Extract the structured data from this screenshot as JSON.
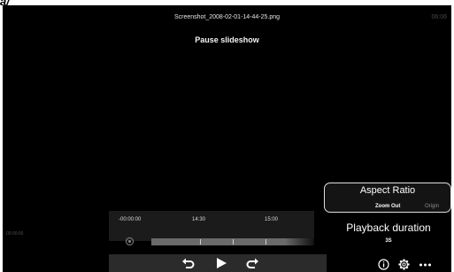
{
  "corner_mark": "a/",
  "viewer": {
    "title": "Screenshot_2008-02-01-14-44-25.png",
    "clock": "06:06",
    "pause_label": "Pause slideshow"
  },
  "timeline": {
    "start": "-00:00:00",
    "mid": "14:30",
    "end": "15:00",
    "left_time": "00:00:00",
    "progress": 0.82
  },
  "aspect_ratio": {
    "title": "Aspect Ratio",
    "options": [
      "Zoom Out",
      "Origin"
    ],
    "selected": "Zoom Out"
  },
  "playback": {
    "title": "Playback duration",
    "value": "3S"
  },
  "icons": {
    "marker": "marker-icon",
    "undo": "undo-icon",
    "play": "play-icon",
    "redo": "redo-icon",
    "info": "info-icon",
    "settings": "gear-icon",
    "more": "more-icon"
  }
}
